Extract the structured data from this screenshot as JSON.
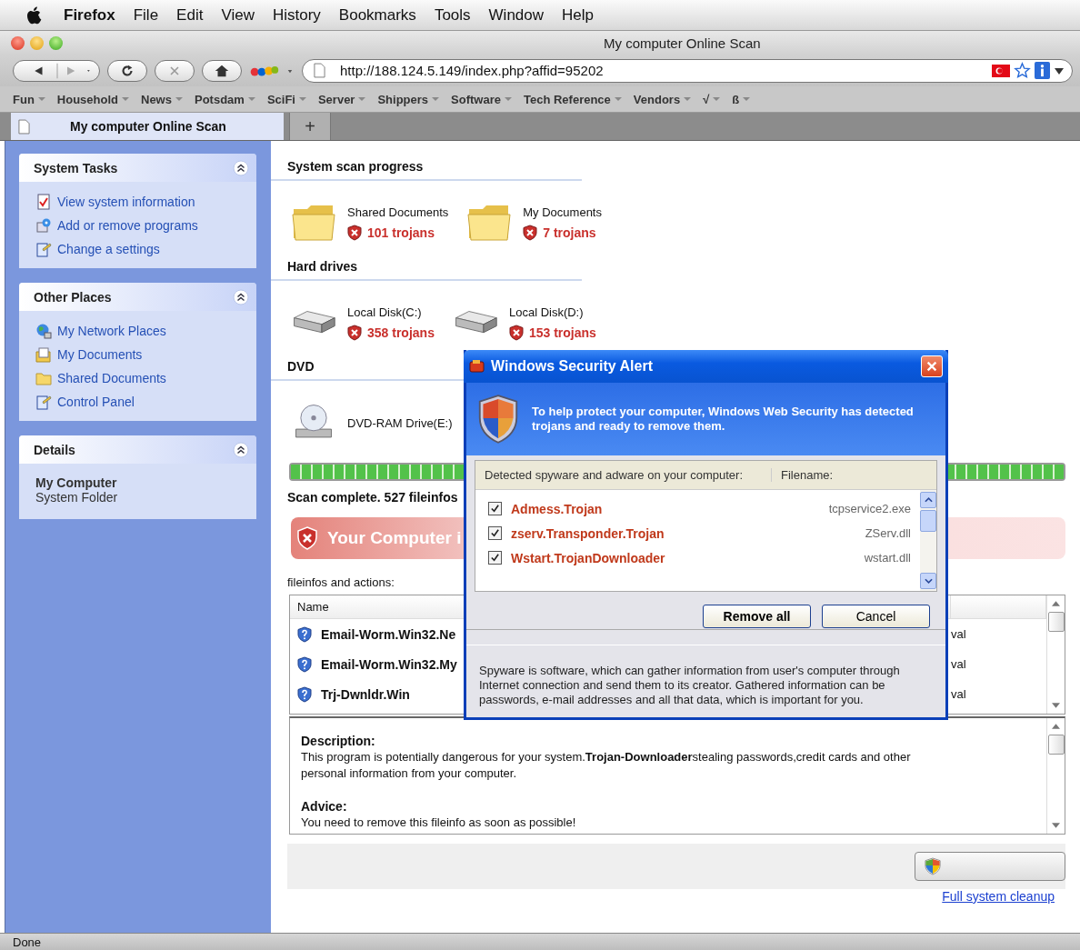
{
  "menubar": {
    "app": "Firefox",
    "items": [
      "File",
      "Edit",
      "View",
      "History",
      "Bookmarks",
      "Tools",
      "Window",
      "Help"
    ]
  },
  "window": {
    "title": "My computer Online Scan"
  },
  "toolbar": {
    "url": "http://188.124.5.149/index.php?affid=95202"
  },
  "bookmarks": [
    "Fun",
    "Household",
    "News",
    "Potsdam",
    "SciFi",
    "Server",
    "Shippers",
    "Software",
    "Tech Reference",
    "Vendors",
    "√",
    "ß"
  ],
  "tabs": [
    {
      "label": "My computer Online Scan",
      "selected": true
    }
  ],
  "new_tab": "+",
  "sidebar": {
    "panels": [
      {
        "title": "System Tasks",
        "items": [
          "View system information",
          "Add or remove programs",
          "Change a settings"
        ]
      },
      {
        "title": "Other Places",
        "items": [
          "My Network Places",
          "My Documents",
          "Shared Documents",
          "Control Panel"
        ]
      },
      {
        "title": "Details",
        "name": "My Computer",
        "subtitle": "System Folder"
      }
    ]
  },
  "scan": {
    "sections": [
      {
        "title": "System scan progress",
        "items": [
          {
            "kind": "folder",
            "name": "Shared Documents",
            "count": "101 trojans"
          },
          {
            "kind": "folder",
            "name": "My Documents",
            "count": "7 trojans"
          }
        ]
      },
      {
        "title": "Hard drives",
        "items": [
          {
            "kind": "disk",
            "name": "Local Disk(C:)",
            "count": "358 trojans"
          },
          {
            "kind": "disk",
            "name": "Local Disk(D:)",
            "count": "153 trojans"
          }
        ]
      },
      {
        "title": "DVD",
        "items": [
          {
            "kind": "dvd",
            "name": "DVD-RAM Drive(E:)"
          }
        ]
      }
    ],
    "progress": {
      "level": 1
    },
    "status": "Scan complete. 527 fileinfos",
    "alert": "Your Computer i",
    "list_label": "fileinfos and actions:"
  },
  "table": {
    "columns": [
      "Name"
    ],
    "rows": [
      {
        "name": "Email-Worm.Win32.Ne",
        "column_3": "val"
      },
      {
        "name": "Email-Worm.Win32.My",
        "column_3": "val"
      },
      {
        "name": "Trj-Dwnldr.Win",
        "column_3": "val"
      }
    ]
  },
  "details": {
    "description_title": "Description:",
    "description": "This program is potentially dangerous for your system.**Trojan-Downloader**stealing passwords,credit cards and other personal information from your computer.",
    "advice_title": "Advice:",
    "advice": "You need to remove this fileinfo as soon as possible!"
  },
  "cleanup_link": "Full system cleanup",
  "status_bar": "Done",
  "dialog": {
    "title": "Windows Security Alert",
    "message": "To help protect your computer, Windows Web Security has detected trojans and ready to remove them.",
    "columns": [
      "Detected spyware and adware on your computer:",
      "Filename:"
    ],
    "rows": [
      {
        "name": "Admess.Trojan",
        "file": "tcpservice2.exe",
        "checked": true
      },
      {
        "name": "zserv.Transponder.Trojan",
        "file": "ZServ.dll",
        "checked": true
      },
      {
        "name": "Wstart.TrojanDownloader",
        "file": "wstart.dll",
        "checked": true
      }
    ],
    "buttons": [
      "Remove all",
      "Cancel"
    ],
    "info": "Spyware is software, which can gather information from user's computer through Internet connection and send them to its creator. Gathered information can be passwords, e-mail addresses and all that data, which is important for you."
  }
}
